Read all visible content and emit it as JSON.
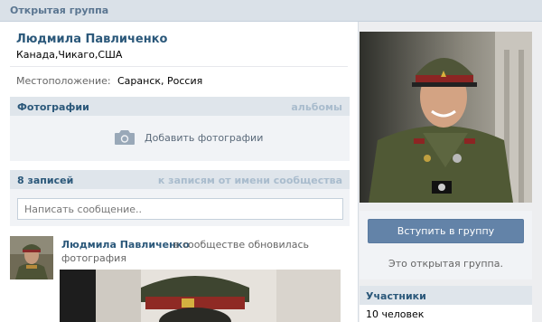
{
  "topbar": {
    "title": "Открытая группа"
  },
  "page": {
    "name": "Людмила Павличенко",
    "status": "Канада,Чикаго,США",
    "info": {
      "location_label": "Местоположение:",
      "location_value": "Саранск, Россия"
    }
  },
  "photos": {
    "title": "Фотографии",
    "albums_link": "альбомы",
    "add_label": "Добавить фотографии",
    "icon": "camera-icon"
  },
  "wall": {
    "count_label": "8 записей",
    "community_link": "к записям от имени сообщества",
    "input_placeholder": "Написать сообщение.."
  },
  "post": {
    "author": "Людмила Павличенко",
    "text_part1": "в сообществе обновилась",
    "text_part2": "фотография"
  },
  "sidebar": {
    "join_button": "Вступить в группу",
    "join_note": "Это открытая группа.",
    "members_title": "Участники",
    "members_count": "10 человек"
  },
  "colors": {
    "link": "#2b587a",
    "header_bg": "#dfe5eb",
    "button": "#6383a8"
  }
}
